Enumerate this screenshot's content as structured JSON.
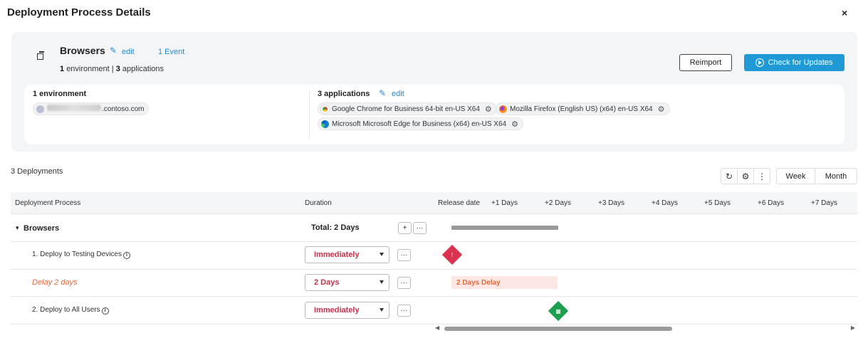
{
  "header": {
    "title": "Deployment Process Details",
    "close_glyph": "×"
  },
  "process": {
    "name": "Browsers",
    "edit_label": "edit",
    "event_label": "1 Event",
    "env_count": "1",
    "env_word": "environment",
    "separator": "|",
    "app_count": "3",
    "app_word": "applications"
  },
  "buttons": {
    "reimport": "Reimport",
    "check_updates": "Check for Updates"
  },
  "environments": {
    "heading": "1 environment",
    "items": [
      {
        "host_suffix": ".contoso.com",
        "host_prefix_obscured": true
      }
    ]
  },
  "applications": {
    "heading": "3 applications",
    "edit_label": "edit",
    "items": [
      {
        "label": "Google Chrome for Business 64-bit en-US X64",
        "icon": "chrome-icon"
      },
      {
        "label": "Mozilla Firefox (English US) (x64) en-US X64",
        "icon": "firefox-icon"
      },
      {
        "label": "Microsoft Microsoft Edge for Business (x64) en-US X64",
        "icon": "edge-icon"
      }
    ]
  },
  "deployments": {
    "count_label": "3 Deployments",
    "views": [
      "Week",
      "Month"
    ],
    "columns": {
      "process": "Deployment Process",
      "duration": "Duration",
      "release": "Release date"
    },
    "timeline_days": [
      "+1 Days",
      "+2 Days",
      "+3 Days",
      "+4 Days",
      "+5 Days",
      "+6 Days",
      "+7 Days"
    ],
    "group": {
      "name": "Browsers",
      "total": "Total: 2 Days",
      "collapse_glyph": "▾",
      "plus": "+",
      "more": "···"
    },
    "rows": [
      {
        "label": "1. Deploy to Testing Devices",
        "duration": "Immediately",
        "type": "step"
      },
      {
        "label": "Delay 2 days",
        "duration": "2 Days",
        "type": "delay",
        "bar_label": "2 Days Delay"
      },
      {
        "label": "2. Deploy to All Users",
        "duration": "Immediately",
        "type": "step"
      }
    ]
  },
  "colors": {
    "accent": "#1f9ad6",
    "link": "#1f8ad2",
    "danger": "#d9334f",
    "success": "#1e9e4f",
    "delay_text": "#e06a3b"
  }
}
